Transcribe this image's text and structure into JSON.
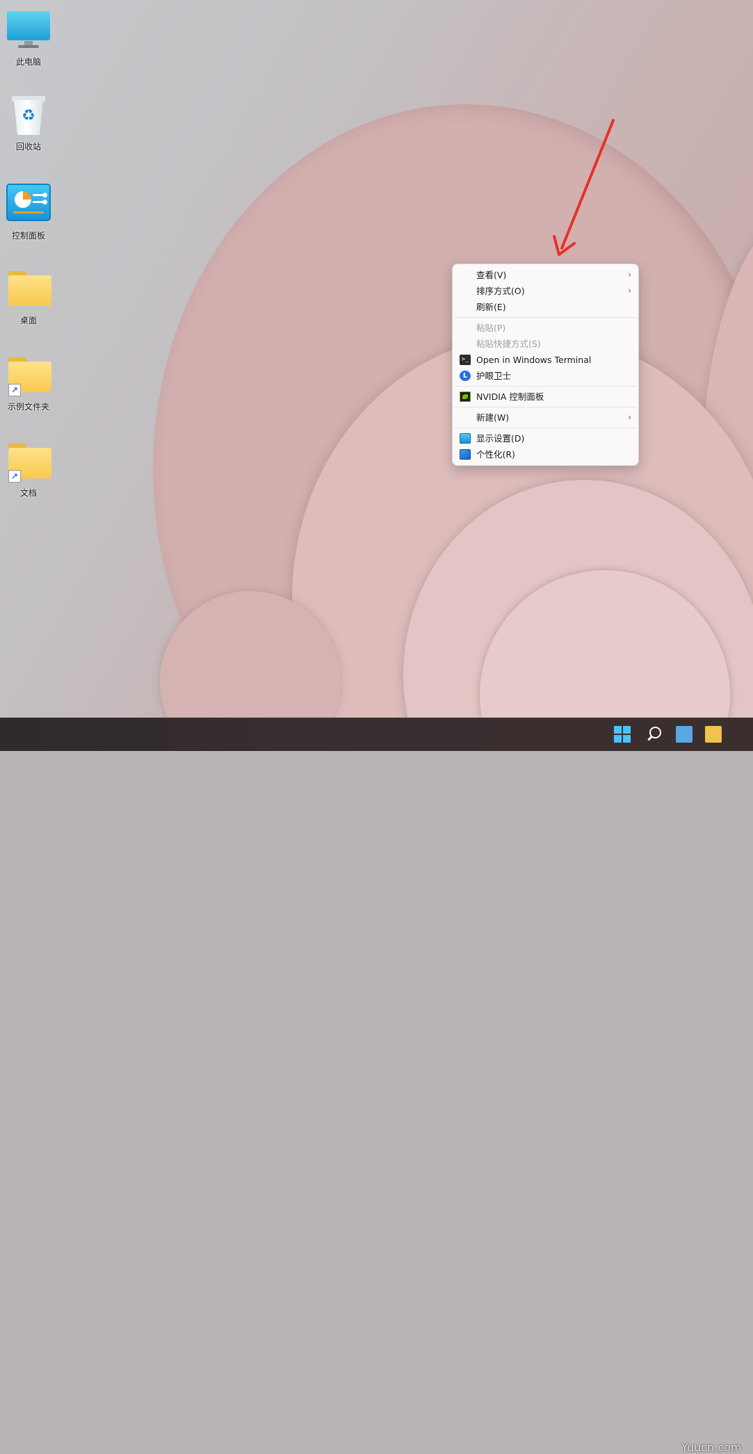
{
  "desktop": {
    "icons": [
      {
        "label": "此电脑",
        "icon": "monitor-icon"
      },
      {
        "label": "回收站",
        "icon": "recycle-bin-icon"
      },
      {
        "label": "控制面板",
        "icon": "control-panel-icon"
      },
      {
        "label": "桌面",
        "icon": "folder-icon"
      },
      {
        "label": "示例文件夹",
        "icon": "folder-shortcut-icon"
      },
      {
        "label": "文档",
        "icon": "folder-shortcut-icon"
      }
    ]
  },
  "context_menu": {
    "items": [
      {
        "label": "查看(V)",
        "has_submenu": true
      },
      {
        "label": "排序方式(O)",
        "has_submenu": true
      },
      {
        "label": "刷新(E)"
      },
      {
        "label": "粘贴(P)",
        "disabled": true
      },
      {
        "label": "粘贴快捷方式(S)",
        "disabled": true
      },
      {
        "label": "Open in Windows Terminal",
        "icon": "terminal-icon"
      },
      {
        "label": "护眼卫士",
        "icon": "eye-guard-icon"
      },
      {
        "label": "NVIDIA 控制面板",
        "icon": "nvidia-icon"
      },
      {
        "label": "新建(W)",
        "has_submenu": true
      },
      {
        "label": "显示设置(D)",
        "icon": "display-icon"
      },
      {
        "label": "个性化(R)",
        "icon": "personalize-icon"
      }
    ],
    "chevron": "›"
  },
  "glyphs": {
    "terminal": ">_",
    "eye_guard": "L",
    "recycle": "♻",
    "shortcut": "↗"
  },
  "watermark": "Yuucn.com",
  "colors": {
    "accent": "#4cc2ff",
    "arrow": "#e8302a",
    "menu_bg": "#f9f9f9"
  }
}
